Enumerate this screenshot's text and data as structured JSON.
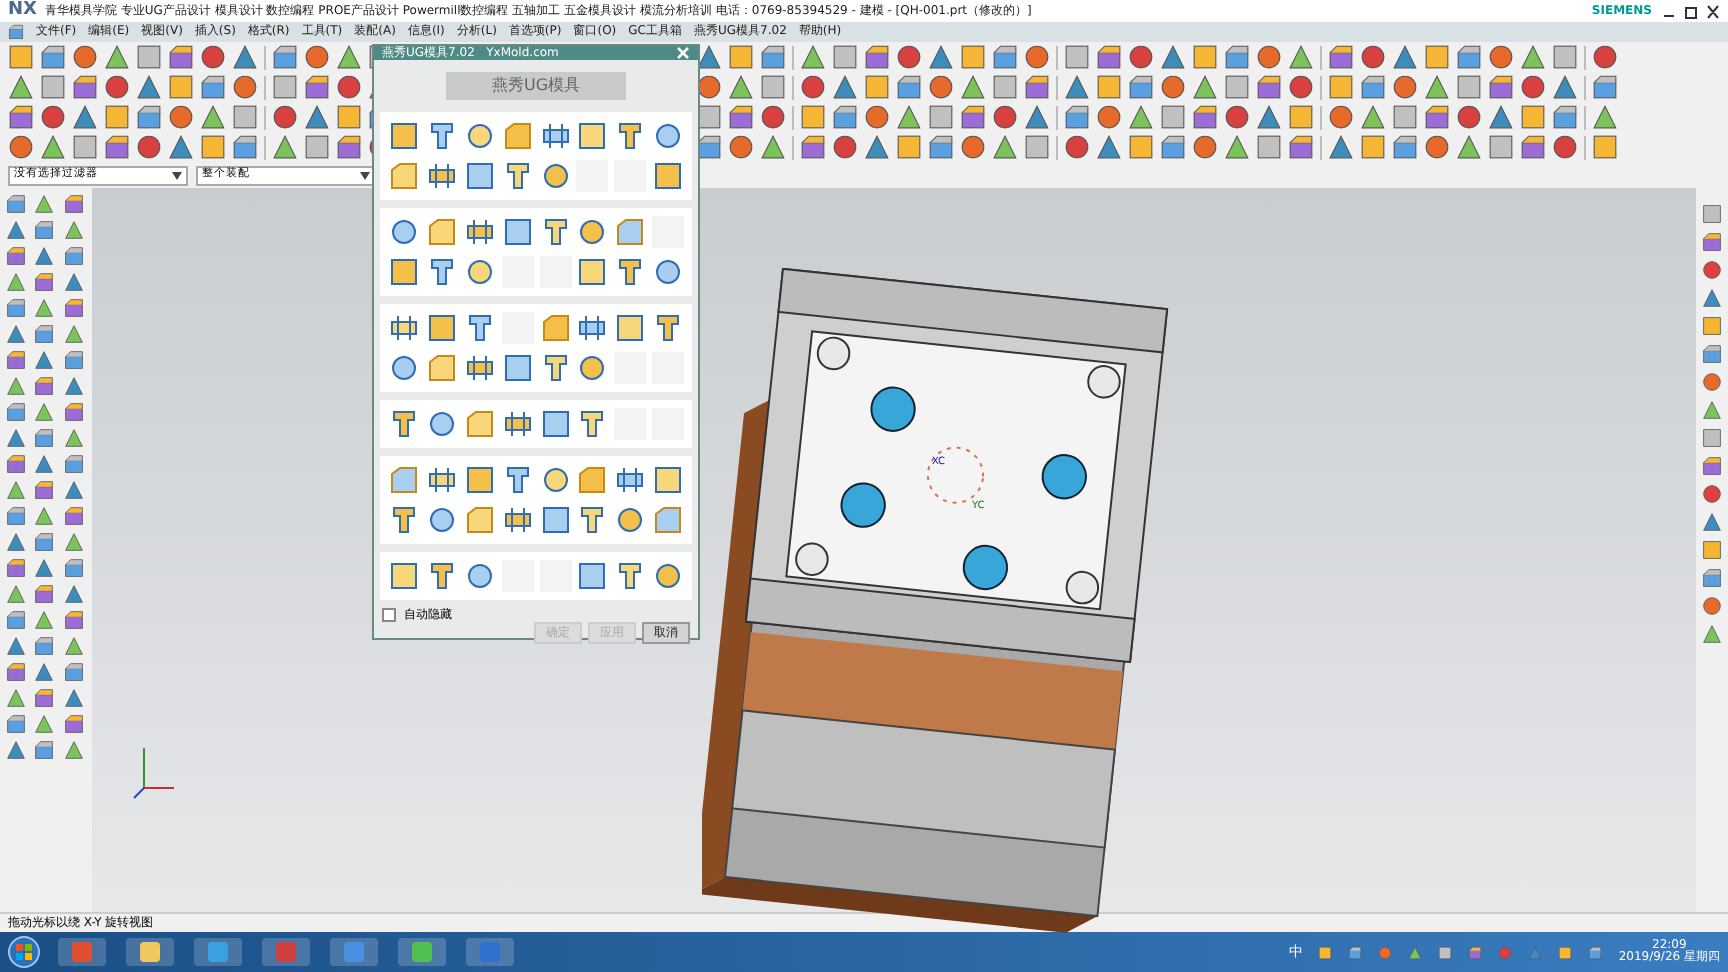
{
  "window": {
    "app_mark": "NX",
    "title": "青华模具学院 专业UG产品设计 模具设计 数控编程 PROE产品设计 Powermill数控编程 五轴加工 五金模具设计 模流分析培训 电话：0769-85394529 - 建模 - [QH-001.prt（修改的）]",
    "brand": "SIEMENS"
  },
  "menu": [
    {
      "label": "文件(F)"
    },
    {
      "label": "编辑(E)"
    },
    {
      "label": "视图(V)"
    },
    {
      "label": "插入(S)"
    },
    {
      "label": "格式(R)"
    },
    {
      "label": "工具(T)"
    },
    {
      "label": "装配(A)"
    },
    {
      "label": "信息(I)"
    },
    {
      "label": "分析(L)"
    },
    {
      "label": "首选项(P)"
    },
    {
      "label": "窗口(O)"
    },
    {
      "label": "GC工具箱"
    },
    {
      "label": "燕秀UG模具7.02"
    },
    {
      "label": "帮助(H)"
    }
  ],
  "filters": [
    {
      "value": "没有选择过滤器"
    },
    {
      "value": "整个装配"
    }
  ],
  "viewport": {
    "axis_labels": [
      "XC",
      "YC"
    ]
  },
  "dialog": {
    "title": "燕秀UG模具7.02   YxMold.com",
    "header_button": "燕秀UG模具",
    "auto_hide": {
      "label": "自动隐藏",
      "checked": false
    },
    "buttons": [
      {
        "label": "确定",
        "disabled": true
      },
      {
        "label": "应用",
        "disabled": true
      },
      {
        "label": "取消",
        "disabled": false
      }
    ]
  },
  "status_bar": {
    "message": "拖动光标以绕 X-Y 旋转视图"
  },
  "taskbar": {
    "ime": "中",
    "time": "22:09",
    "date": "2019/9/26 星期四"
  }
}
